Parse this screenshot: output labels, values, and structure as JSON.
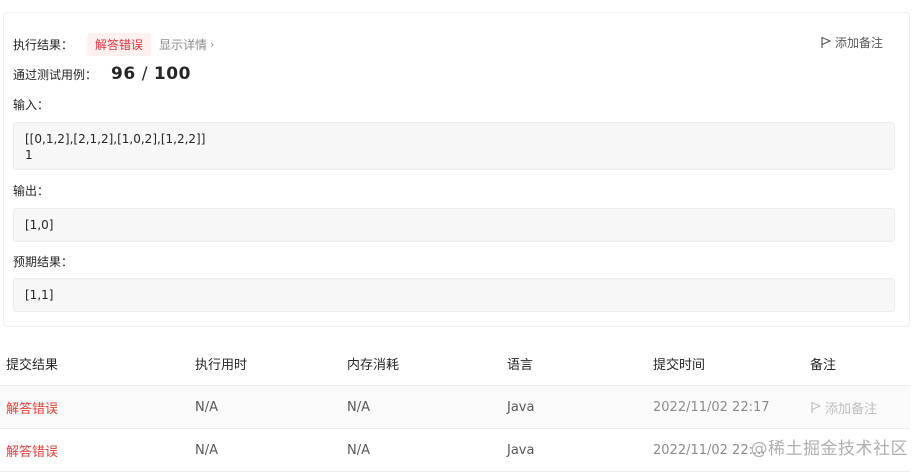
{
  "result": {
    "status_label": "执行结果：",
    "status_value": "解答错误",
    "details_link": "显示详情",
    "add_note": "添加备注",
    "passed_label": "通过测试用例：",
    "passed_count": "96",
    "passed_sep": "/",
    "passed_total": "100",
    "input_label": "输入：",
    "input_lines": [
      "[[0,1,2],[2,1,2],[1,0,2],[1,2,2]]",
      "1"
    ],
    "output_label": "输出：",
    "output_value": "[1,0]",
    "expected_label": "预期结果：",
    "expected_value": "[1,1]"
  },
  "table": {
    "headers": [
      "提交结果",
      "执行用时",
      "内存消耗",
      "语言",
      "提交时间",
      "备注"
    ],
    "rows": [
      {
        "result": "解答错误",
        "runtime": "N/A",
        "memory": "N/A",
        "language": "Java",
        "time": "2022/11/02 22:17",
        "note": "添加备注"
      },
      {
        "result": "解答错误",
        "runtime": "N/A",
        "memory": "N/A",
        "language": "Java",
        "time": "2022/11/02 22:..."
      }
    ]
  },
  "watermark": "@稀土掘金技术社区",
  "icons": [
    "flag-icon",
    "chevron-right-icon"
  ],
  "colors": {
    "error": "#e0443c",
    "badge_bg": "#fef1f0",
    "code_bg": "#f7f7f7"
  }
}
